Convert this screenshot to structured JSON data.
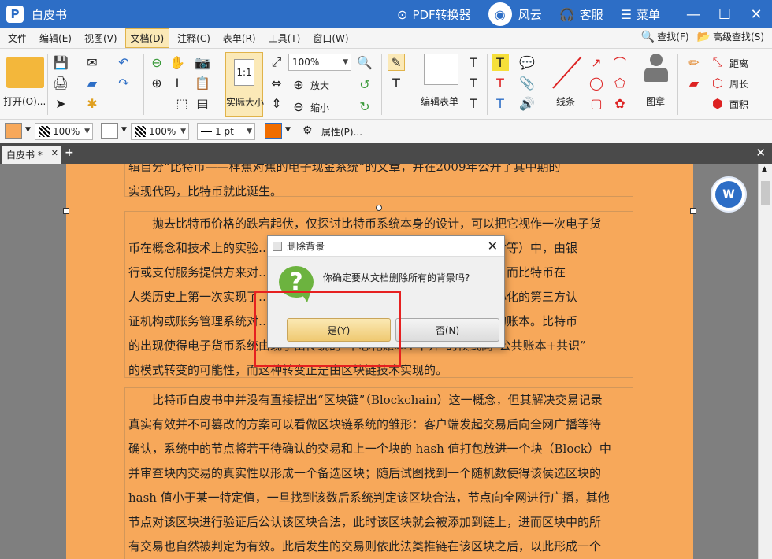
{
  "app": {
    "logo": "P",
    "title": "白皮书",
    "pdf_converter": "PDF转换器",
    "fengyun": "风云",
    "service": "客服",
    "menu": "菜单"
  },
  "menubar": {
    "items": [
      "文件",
      "编辑(E)",
      "视图(V)",
      "文档(D)",
      "注释(C)",
      "表单(R)",
      "工具(T)",
      "窗口(W)"
    ],
    "find": "查找(F)",
    "advanced_find": "高级查找(S)"
  },
  "ribbon": {
    "open": "打开(O)...",
    "actual_size": "实际大小",
    "actual_size_glyph": "1:1",
    "zoom_value": "100%",
    "zoom_in": "放大",
    "zoom_out": "缩小",
    "edit_form": "编辑表单",
    "line": "线条",
    "stamp": "图章",
    "distance": "距离",
    "perimeter": "周长",
    "area": "面积"
  },
  "propbar": {
    "fill_opacity": "100%",
    "stroke_opacity": "100%",
    "line_width": "1 pt",
    "properties": "属性(P)..."
  },
  "tabs": {
    "doc_tab": "白皮书 *"
  },
  "document": {
    "para1_lines": [
      "辑自分“比特币——样蕉对蕉的电子现金系统”的文章，并在2009年公开了其中期的",
      "实现代码，比特币就此诞生。"
    ],
    "para2_lines": [
      "抛去比特币价格的跌宕起伏，仅探讨比特币系统本身的设计，可以把它视作一次电子货",
      "币在概念和技术上的实验……………………………………………三方支付等）中，由银",
      "行或支付服务提供方来对……………………………………………构手中；而比特币在",
      "人类历史上第一次实现了……………………………………………一个中心化的第三方认",
      "证机构或账务管理系统对……………………………………………份相同的账本。比特币",
      "的出现使得电子货币系统由现了由传统的“中心化账本+中介”的模式向“公共账本+共识”",
      "的模式转变的可能性，而这种转变正是由区块链技术实现的。"
    ],
    "para3_lines": [
      "比特币白皮书中并没有直接提出“区块链”（Blockchain）这一概念，但其解决交易记录",
      "真实有效并不可篡改的方案可以看做区块链系统的雏形：客户端发起交易后向全网广播等待",
      "确认，系统中的节点将若干待确认的交易和上一个块的 hash 值打包放进一个块（Block）中",
      "并审查块内交易的真实性以形成一个备选区块；随后试图找到一个随机数使得该侯选区块的",
      "hash 值小于某一特定值，一旦找到该数后系统判定该区块合法，节点向全网进行广播，其他",
      "节点对该区块进行验证后公认该区块合法，此时该区块就会被添加到链上，进而区块中的所",
      "有交易也自然被判定为有效。此后发生的交易则依此法类推链在该区块之后，以此形成一个"
    ]
  },
  "dialog": {
    "title": "删除背景",
    "message": "你确定要从文档删除所有的背景吗?",
    "yes": "是(Y)",
    "no": "否(N)"
  },
  "colors": {
    "titlebar": "#2d6ec6",
    "page_bg": "#f7a85a",
    "highlight": "#e62020"
  }
}
